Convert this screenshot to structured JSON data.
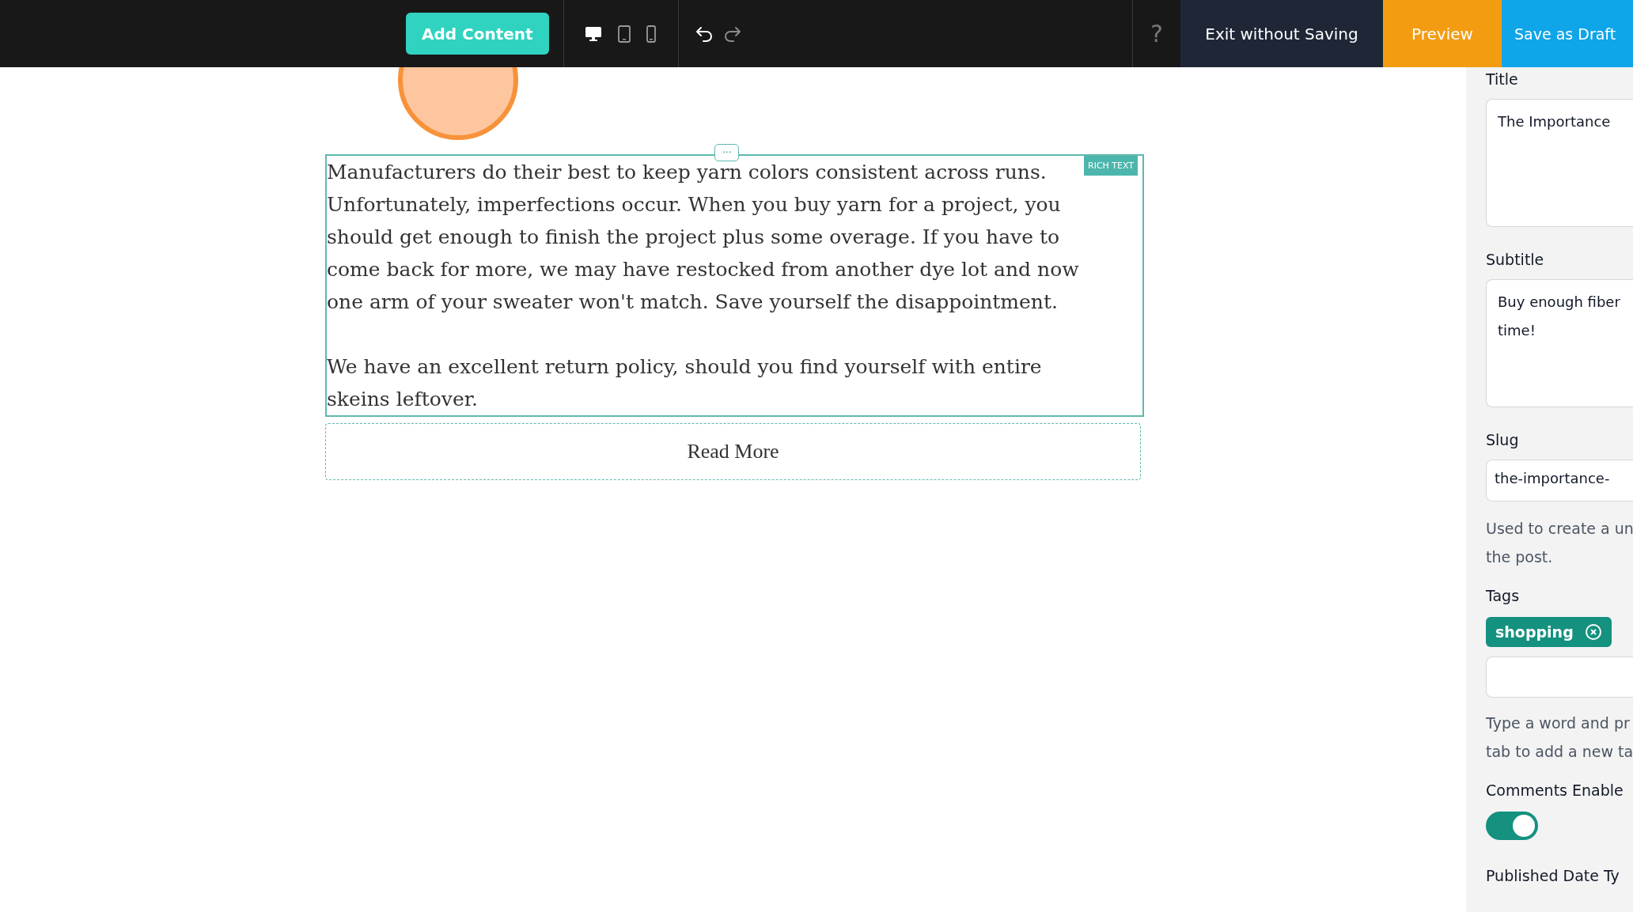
{
  "toolbar": {
    "add_button": "Add Content",
    "devices": [
      {
        "kind": "desktop",
        "selected": true
      },
      {
        "kind": "tablet",
        "selected": false
      },
      {
        "kind": "phone",
        "selected": false
      }
    ],
    "help": "?",
    "actions": [
      {
        "kind": "exit",
        "label": "Exit without Saving"
      },
      {
        "kind": "preview",
        "label": "Preview"
      },
      {
        "kind": "draft",
        "label": "Save as Draft"
      }
    ]
  },
  "canvas": {
    "block_label": "RICH TEXT",
    "handle": "···",
    "paragraphs": [
      "Manufacturers do their best to keep yarn colors consistent across runs. Unfortunately, imperfections occur. When you buy yarn for a project, you should get enough to finish the project plus some overage. If you have to come back for more, we may have restocked from another dye lot and now one arm of your sweater won't match. Save yourself the disappointment.",
      "We have an excellent return policy, should you find yourself with entire skeins leftover."
    ],
    "read_more": "Read More"
  },
  "panel": {
    "title": {
      "label": "Title",
      "value": "The Importance"
    },
    "subtitle": {
      "label": "Subtitle",
      "lines": [
        "Buy enough fiber",
        "time!"
      ]
    },
    "slug": {
      "label": "Slug",
      "value": "the-importance-",
      "help_lines": [
        "Used to create a un",
        "the post."
      ]
    },
    "tags": {
      "label": "Tags",
      "items": [
        "shopping"
      ],
      "help_lines": [
        "Type a word and pr",
        "tab to add a new ta"
      ]
    },
    "comments": {
      "label": "Comments Enable",
      "on": true
    },
    "published": {
      "label": "Published Date Ty"
    }
  }
}
